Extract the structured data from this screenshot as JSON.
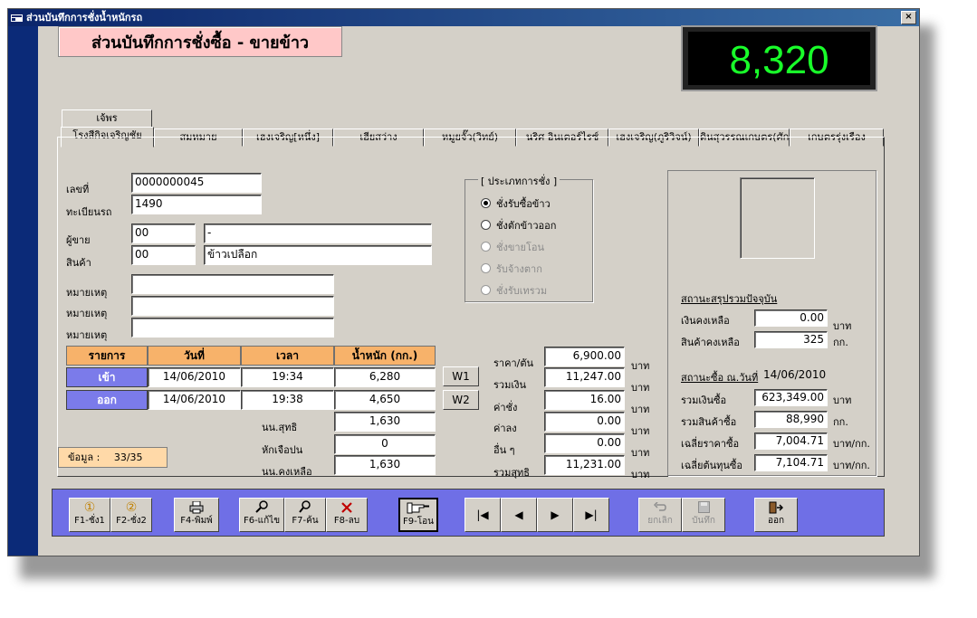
{
  "window": {
    "title": "ส่วนบันทึกการชั่งน้ำหนักรถ",
    "close_glyph": "×"
  },
  "header": {
    "title": "ส่วนบันทึกการชั่งซื้อ - ขายข้าว"
  },
  "scale_display": "8,320",
  "tabs": {
    "top_row": [
      "เจ้พร"
    ],
    "bottom_row": [
      "โรงสีกิจเจริญชัย",
      "สมหมาย",
      "เฮงเจริญ[หนึ่ง]",
      "เฮียสว่าง",
      "หมูยจั๊ว(วิทย์)",
      "นริศ อินเตอร์ไรซ์",
      "เฮงเจริญ(ภูริวิจน์)",
      "ดินสุวรรณเกษตร(ศักดิ์",
      "เกษตรรุ่งเรือง"
    ]
  },
  "form": {
    "doc_no_label": "เลขที่",
    "doc_no": "0000000045",
    "plate_label": "ทะเบียนรถ",
    "plate": "1490",
    "seller_label": "ผู้ขาย",
    "seller_code": "00",
    "seller_name": "-",
    "product_label": "สินค้า",
    "product_code": "00",
    "product_name": "ข้าวเปลือก",
    "note_label": "หมายเหตุ"
  },
  "weigh_type": {
    "legend": "[ ประเภทการชั่ง ]",
    "options": [
      "ชั่งรับซื้อข้าว",
      "ชั่งตักข้าวออก",
      "ชั่งขายโอน",
      "รับจ้างตาก",
      "ชั่งรับเทรวม"
    ]
  },
  "weighings": {
    "headers": [
      "รายการ",
      "วันที่",
      "เวลา",
      "น้ำหนัก (กก.)"
    ],
    "rows": [
      {
        "label": "เข้า",
        "date": "14/06/2010",
        "time": "19:34",
        "weight": "6,280"
      },
      {
        "label": "ออก",
        "date": "14/06/2010",
        "time": "19:38",
        "weight": "4,650"
      }
    ],
    "net_label": "นน.สุทธิ",
    "net": "1,630",
    "deduct_label": "หักเจือปน",
    "deduct": "0",
    "remain_label": "นน.คงเหลือ",
    "remain": "1,630"
  },
  "w_buttons": [
    "W1",
    "W2"
  ],
  "pricing": {
    "price_label": "ราคา/ตัน",
    "price": "6,900.00",
    "total_label": "รวมเงิน",
    "total": "11,247.00",
    "fee_label": "ค่าชั่ง",
    "fee": "16.00",
    "labor_label": "ค่าลง",
    "labor": "0.00",
    "other_label": "อื่น ๆ",
    "other": "0.00",
    "net_label": "รวมสุทธิ",
    "net": "11,231.00",
    "unit": "บาท"
  },
  "status": {
    "summary_title": "สถานะสรุปรวมปัจจุบัน",
    "cash_label": "เงินคงเหลือ",
    "cash": "0.00",
    "cash_unit": "บาท",
    "stock_label": "สินค้าคงเหลือ",
    "stock": "325",
    "stock_unit": "กก.",
    "daily_title": "สถานะซื้อ ณ.วันที่",
    "daily_date": "14/06/2010",
    "buy_total_label": "รวมเงินซื้อ",
    "buy_total": "623,349.00",
    "buy_total_unit": "บาท",
    "buy_qty_label": "รวมสินค้าซื้อ",
    "buy_qty": "88,990",
    "buy_qty_unit": "กก.",
    "avg_price_label": "เฉลี่ยราคาซื้อ",
    "avg_price": "7,004.71",
    "avg_price_unit": "บาท/กก.",
    "avg_cost_label": "เฉลี่ยต้นทุนซื้อ",
    "avg_cost": "7,104.71",
    "avg_cost_unit": "บาท/กก."
  },
  "record_info": {
    "label": "ข้อมูล :",
    "value": "33/35"
  },
  "toolbar": {
    "f1": "F1-ชั่ง1",
    "f2": "F2-ชั่ง2",
    "f4": "F4-พิมพ์",
    "f6": "F6-แก้ไข",
    "f7": "F7-ค้น",
    "f8": "F8-ลบ",
    "f9": "F9-โอน",
    "cancel": "ยกเลิก",
    "save": "บันทึก",
    "exit": "ออก",
    "f1_icon": "①",
    "f2_icon": "②",
    "nav_first": "|◀",
    "nav_prev": "◀",
    "nav_next": "▶",
    "nav_last": "▶|"
  }
}
